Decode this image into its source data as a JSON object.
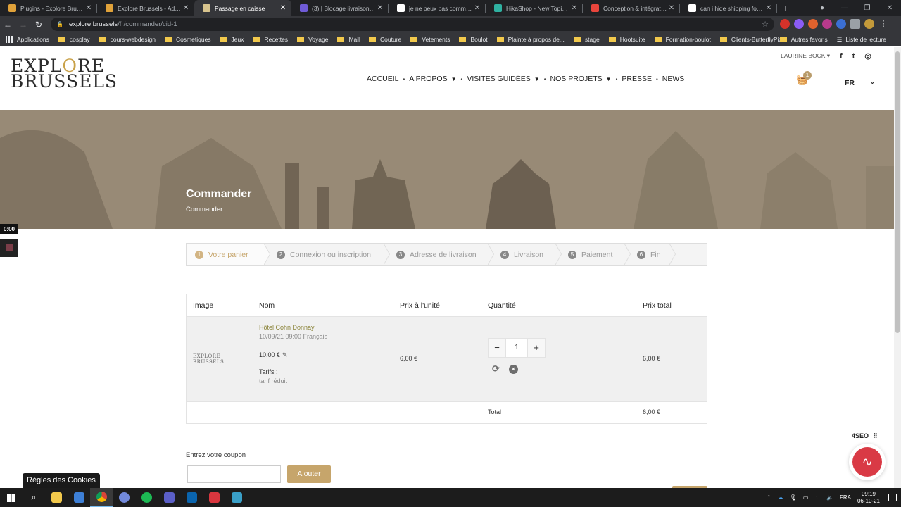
{
  "browser": {
    "tabs": [
      {
        "title": "Plugins - Explore Brussels",
        "color": "#e0a23a",
        "active": false
      },
      {
        "title": "Explore Brussels - Administration",
        "color": "#e0a23a",
        "active": false
      },
      {
        "title": "Passage en caisse",
        "color": "#d8c48e",
        "active": true
      },
      {
        "title": "(3) | Blocage livraison - Explore",
        "color": "#6f5bd6",
        "active": false
      },
      {
        "title": "je ne peux pas commander",
        "color": "#ffffff",
        "active": false
      },
      {
        "title": "HikaShop - New Topic - HikaShop",
        "color": "#2fb1a1",
        "active": false
      },
      {
        "title": "Conception & intégration",
        "color": "#e8453c",
        "active": false
      },
      {
        "title": "can i hide shipping for category",
        "color": "#ffffff",
        "active": false
      }
    ],
    "new_tab": "+",
    "url_host": "explore.brussels",
    "url_path": "/fr/commander/cid-1",
    "bookmarks": [
      "Applications",
      "cosplay",
      "cours-webdesign",
      "Cosmetiques",
      "Jeux",
      "Recettes",
      "Voyage",
      "Mail",
      "Couture",
      "Vetements",
      "Boulot",
      "Plainte à propos de...",
      "stage",
      "Hootsuite",
      "Formation-boulot",
      "Clients-ButterflyPixel"
    ],
    "bookmarks_overflow": "»",
    "other_bookmarks": "Autres favoris",
    "reading_list": "Liste de lecture"
  },
  "site": {
    "logo_line1_a": "EXPL",
    "logo_ring": "O",
    "logo_line1_b": "RE",
    "logo_line2": "BRUSSELS",
    "user_menu": "LAURINE BOCK ▾",
    "social": [
      "f",
      "t",
      "◎"
    ],
    "nav": [
      {
        "label": "ACCUEIL",
        "dropdown": false
      },
      {
        "label": "A PROPOS",
        "dropdown": true
      },
      {
        "label": "VISITES GUIDÉES",
        "dropdown": true
      },
      {
        "label": "NOS PROJETS",
        "dropdown": true
      },
      {
        "label": "PRESSE",
        "dropdown": false
      },
      {
        "label": "NEWS",
        "dropdown": false
      }
    ],
    "cart_count": "1",
    "language": "FR",
    "hero_title": "Commander",
    "hero_breadcrumb": "Commander",
    "video_time": "0:00"
  },
  "checkout": {
    "steps": [
      {
        "num": "1",
        "label": "Votre panier",
        "active": true
      },
      {
        "num": "2",
        "label": "Connexion ou inscription",
        "active": false
      },
      {
        "num": "3",
        "label": "Adresse de livraison",
        "active": false
      },
      {
        "num": "4",
        "label": "Livraison",
        "active": false
      },
      {
        "num": "5",
        "label": "Paiement",
        "active": false
      },
      {
        "num": "6",
        "label": "Fin",
        "active": false
      }
    ],
    "headers": {
      "image": "Image",
      "name": "Nom",
      "unit_price": "Prix à l'unité",
      "quantity": "Quantité",
      "total_price": "Prix total"
    },
    "item": {
      "logo_line1": "EXPLORE",
      "logo_line2": "BRUSSELS",
      "name": "Hôtel Cohn Donnay",
      "date": "10/09/21 09:00 Français",
      "price": "10,00 €",
      "tarifs_label": "Tarifs :",
      "tarif": "tarif réduit",
      "unit_price": "6,00 €",
      "quantity": "1",
      "line_total": "6,00 €"
    },
    "total_label": "Total",
    "total_value": "6,00 €",
    "coupon_label": "Entrez votre coupon",
    "coupon_button": "Ajouter"
  },
  "widgets": {
    "cookie": "Règles des Cookies",
    "seo_label": "4SEO"
  },
  "taskbar": {
    "language": "FRA",
    "time": "09:19",
    "date": "06-10-21"
  },
  "colors": {
    "accent": "#c6a56b",
    "product_link": "#8a8338",
    "seo_red": "#d93a45"
  }
}
